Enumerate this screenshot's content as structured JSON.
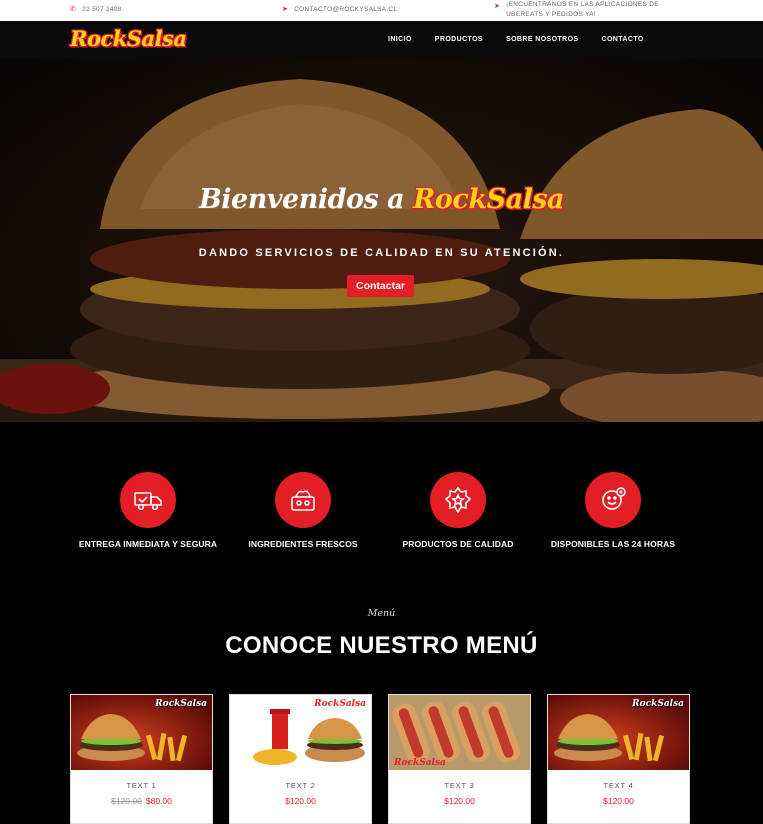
{
  "topbar": {
    "phone": "22 507 2408",
    "email": "CONTACTO@ROCKYSALSA.CL",
    "apps_line1": "¡ENCUENTRANOS EN LAS APLICACIONES DE",
    "apps_line2": "UBEREATS Y PEDIDOS YA!"
  },
  "nav": {
    "logo": "RockSalsa",
    "links": [
      "INICIO",
      "PRODUCTOS",
      "SOBRE NOSOTROS",
      "CONTACTO"
    ]
  },
  "hero": {
    "title_prefix": "Bienvenidos a",
    "title_brand": "RockSalsa",
    "subtitle": "DANDO SERVICIOS DE CALIDAD EN SU ATENCIÓN.",
    "button": "Contactar"
  },
  "features": [
    {
      "label": "ENTREGA INMEDIATA Y SEGURA",
      "icon": "delivery-truck-icon"
    },
    {
      "label": "INGREDIENTES FRESCOS",
      "icon": "fresh-ingredients-icon"
    },
    {
      "label": "PRODUCTOS DE CALIDAD",
      "icon": "quality-badge-icon"
    },
    {
      "label": "DISPONIBLES LAS 24 HORAS",
      "icon": "support-24h-icon"
    }
  ],
  "menu": {
    "eyebrow": "Menú",
    "title": "CONOCE NUESTRO MENÚ",
    "items": [
      {
        "name": "TEXT 1",
        "old_price": "$120.00",
        "price": "$80.00",
        "image": "burger-fries"
      },
      {
        "name": "TEXT 2",
        "old_price": "",
        "price": "$120.00",
        "image": "burger-combo"
      },
      {
        "name": "TEXT 3",
        "old_price": "",
        "price": "$120.00",
        "image": "hotdogs"
      },
      {
        "name": "TEXT 4",
        "old_price": "",
        "price": "$120.00",
        "image": "burger-fries"
      }
    ],
    "image_logo": "RockSalsa"
  },
  "colors": {
    "accent": "#e31e24",
    "brand_yellow": "#ffd21f",
    "background": "#000000"
  }
}
